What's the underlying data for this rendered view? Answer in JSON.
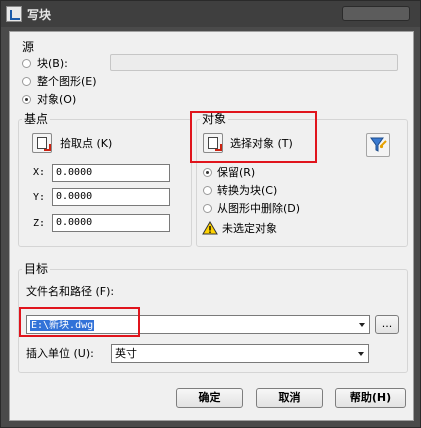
{
  "window": {
    "title": "写块"
  },
  "source": {
    "group_label": "源",
    "options": [
      {
        "label": "块(B):",
        "selected": false
      },
      {
        "label": "整个图形(E)",
        "selected": false
      },
      {
        "label": "对象(O)",
        "selected": true
      }
    ]
  },
  "base_point": {
    "group_label": "基点",
    "pick_label": "拾取点 (K)",
    "x_label": "X:",
    "y_label": "Y:",
    "z_label": "Z:",
    "x_value": "0.0000",
    "y_value": "0.0000",
    "z_value": "0.0000"
  },
  "objects": {
    "group_label": "对象",
    "select_label": "选择对象 (T)",
    "options": [
      {
        "label": "保留(R)",
        "selected": true
      },
      {
        "label": "转换为块(C)",
        "selected": false
      },
      {
        "label": "从图形中删除(D)",
        "selected": false
      }
    ],
    "warning": "未选定对象"
  },
  "target": {
    "group_label": "目标",
    "path_label": "文件名和路径 (F):",
    "path_value": "E:\\新块.dwg",
    "browse_label": "...",
    "units_label": "插入单位 (U):",
    "units_value": "英寸"
  },
  "buttons": {
    "ok": "确定",
    "cancel": "取消",
    "help": "帮助(H)"
  },
  "colors": {
    "highlight": "#e0141c",
    "selection": "#3272d8"
  }
}
